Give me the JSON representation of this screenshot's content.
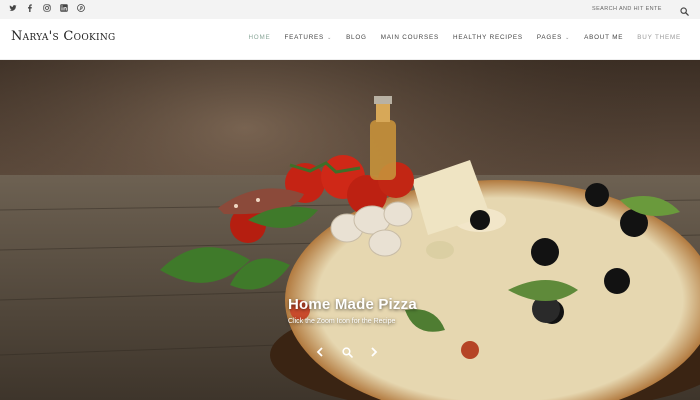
{
  "topbar": {
    "social_icons": [
      "twitter-icon",
      "facebook-icon",
      "instagram-icon",
      "linkedin-icon",
      "pinterest-icon"
    ],
    "search_placeholder": "SEARCH AND HIT ENTER..."
  },
  "header": {
    "logo_text": "Narya's Cooking",
    "nav": [
      {
        "label": "HOME",
        "active": true
      },
      {
        "label": "FEATURES",
        "has_dropdown": true
      },
      {
        "label": "BLOG"
      },
      {
        "label": "MAIN COURSES"
      },
      {
        "label": "HEALTHY RECIPES"
      },
      {
        "label": "PAGES",
        "has_dropdown": true
      },
      {
        "label": "ABOUT ME"
      },
      {
        "label": "BUY THEME"
      }
    ]
  },
  "hero": {
    "title": "Home Made Pizza",
    "subtitle": "Click the Zoom Icon for the Recipe"
  },
  "colors": {
    "accent": "#8ba79a",
    "nav_text": "#444444",
    "topbar_bg": "#f3f3f3"
  }
}
